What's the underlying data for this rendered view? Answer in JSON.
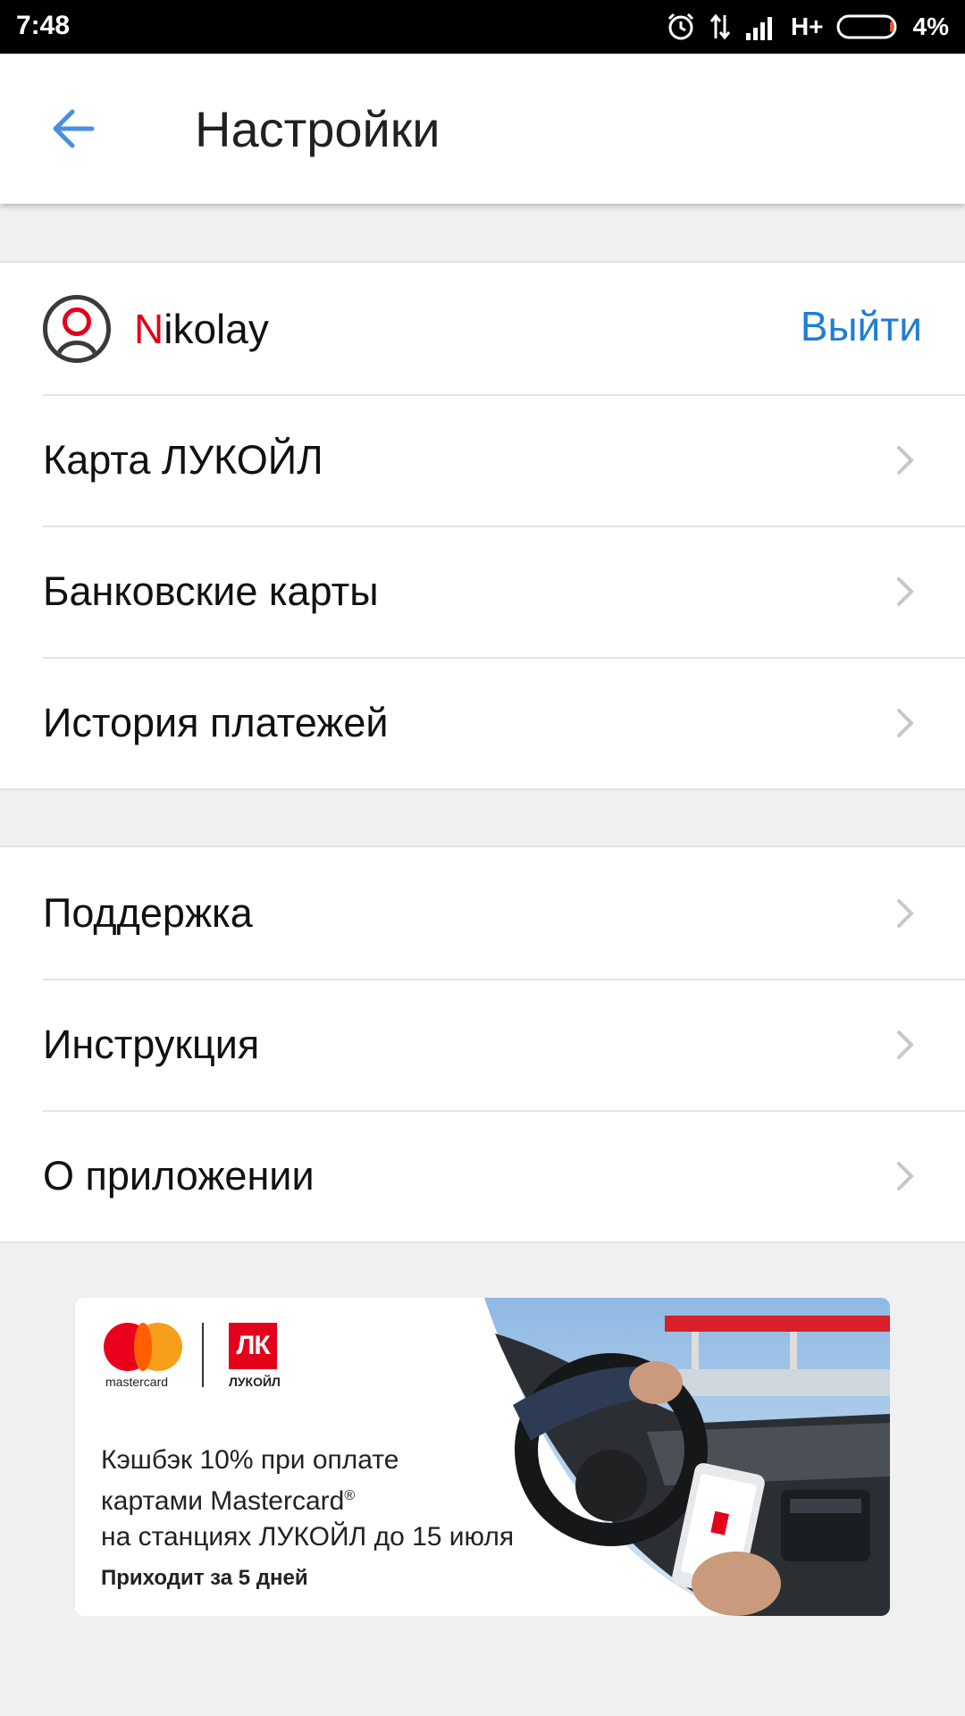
{
  "status_bar": {
    "time": "7:48",
    "network": "H+",
    "battery": "4%",
    "icons": [
      "alarm-icon",
      "data-arrows-icon",
      "signal-icon",
      "battery-icon"
    ]
  },
  "header": {
    "title": "Настройки",
    "back_icon": "arrow-left-icon"
  },
  "user": {
    "name_initial": "N",
    "name_rest": "ikolay",
    "logout_label": "Выйти"
  },
  "account_items": [
    {
      "label": "Карта ЛУКОЙЛ"
    },
    {
      "label": "Банковские карты"
    },
    {
      "label": "История платежей"
    }
  ],
  "info_items": [
    {
      "label": "Поддержка"
    },
    {
      "label": "Инструкция"
    },
    {
      "label": "О приложении"
    }
  ],
  "banner": {
    "mastercard_word": "mastercard",
    "lukoil_mark": "ЛК",
    "lukoil_word": "ЛУКОЙЛ",
    "promo_line1": "Кэшбэк 10% при оплате",
    "promo_line2": "картами Mastercard",
    "promo_reg": "®",
    "promo_line3": "на станциях ЛУКОЙЛ до 15 июля",
    "promo_sub": "Приходит за 5 дней"
  },
  "colors": {
    "accent_blue": "#1f7ed3",
    "back_arrow": "#4a8fe0",
    "lukoil_red": "#e3001b",
    "mastercard_red": "#eb001b",
    "mastercard_orange": "#f79e1b"
  }
}
